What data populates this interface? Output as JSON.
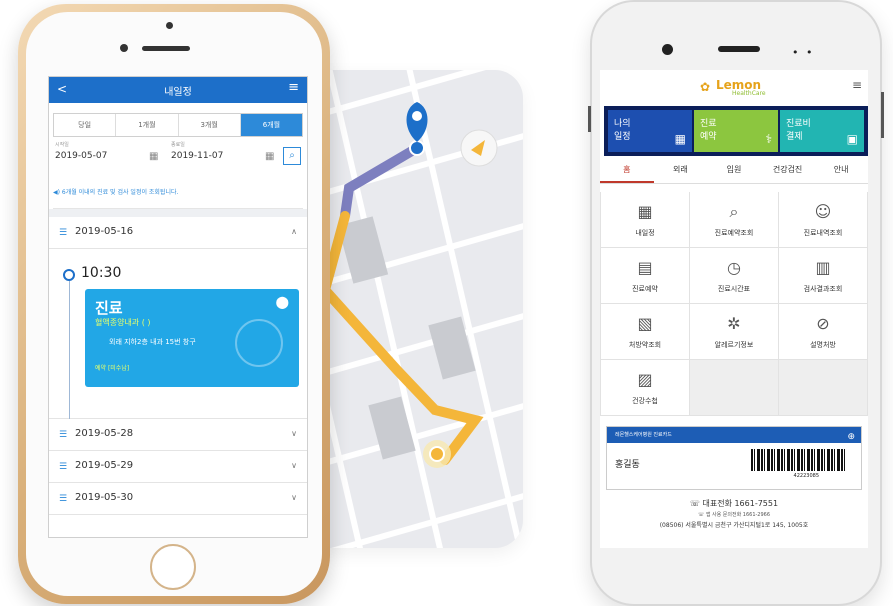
{
  "left_phone": {
    "header": {
      "back": "<",
      "title": "내일정",
      "menu": "≡"
    },
    "period_tabs": [
      "당일",
      "1개월",
      "3개월",
      "6개월"
    ],
    "active_tab": "6개월",
    "start_label": "시작일",
    "end_label": "종료일",
    "start_date": "2019-05-07",
    "end_date": "2019-11-07",
    "notice": "6개월 이내의 진료 및 검사 일정이 조회됩니다.",
    "expanded_date": "2019-05-16",
    "appointment": {
      "time": "10:30",
      "type": "진료",
      "department": "혈액종양내과 (        )",
      "location": "외래 지하2층 내과 15번 창구",
      "status": "예약 [미수납]"
    },
    "collapsed_dates": [
      "2019-05-28",
      "2019-05-29",
      "2019-05-30"
    ]
  },
  "right_phone": {
    "logo_text": "Lemon",
    "logo_sub": "HealthCare",
    "tiles": [
      {
        "label1": "나의",
        "label2": "일정",
        "icon": "calendar-icon"
      },
      {
        "label1": "진료",
        "label2": "예약",
        "icon": "doctor-icon"
      },
      {
        "label1": "진료비",
        "label2": "결제",
        "icon": "wallet-icon"
      }
    ],
    "tabs": [
      "홈",
      "외래",
      "입원",
      "건강검진",
      "안내"
    ],
    "active_tab": "홈",
    "grid": [
      {
        "label": "내일정",
        "icon": "calendar-icon"
      },
      {
        "label": "진료예약조회",
        "icon": "search-icon"
      },
      {
        "label": "진료내역조회",
        "icon": "user-icon"
      },
      {
        "label": "진료예약",
        "icon": "calendar-add-icon"
      },
      {
        "label": "진료시간표",
        "icon": "clock-icon"
      },
      {
        "label": "검사결과조회",
        "icon": "clipboard-icon"
      },
      {
        "label": "처방약조회",
        "icon": "prescription-icon"
      },
      {
        "label": "알레르기정보",
        "icon": "allergy-icon"
      },
      {
        "label": "설명처방",
        "icon": "pill-icon"
      },
      {
        "label": "건강수첩",
        "icon": "book-icon"
      }
    ],
    "card": {
      "title": "레몬헬스케어병원 진료카드",
      "name": "홍길동",
      "barcode_number": "42223085"
    },
    "footer": {
      "main_phone": "대표전화 1661-7551",
      "app_phone": "앱 사용 문의전화 1661-2966",
      "address": "(08506) 서울특별시 금천구 가산디지털1로 145, 1005호"
    }
  }
}
